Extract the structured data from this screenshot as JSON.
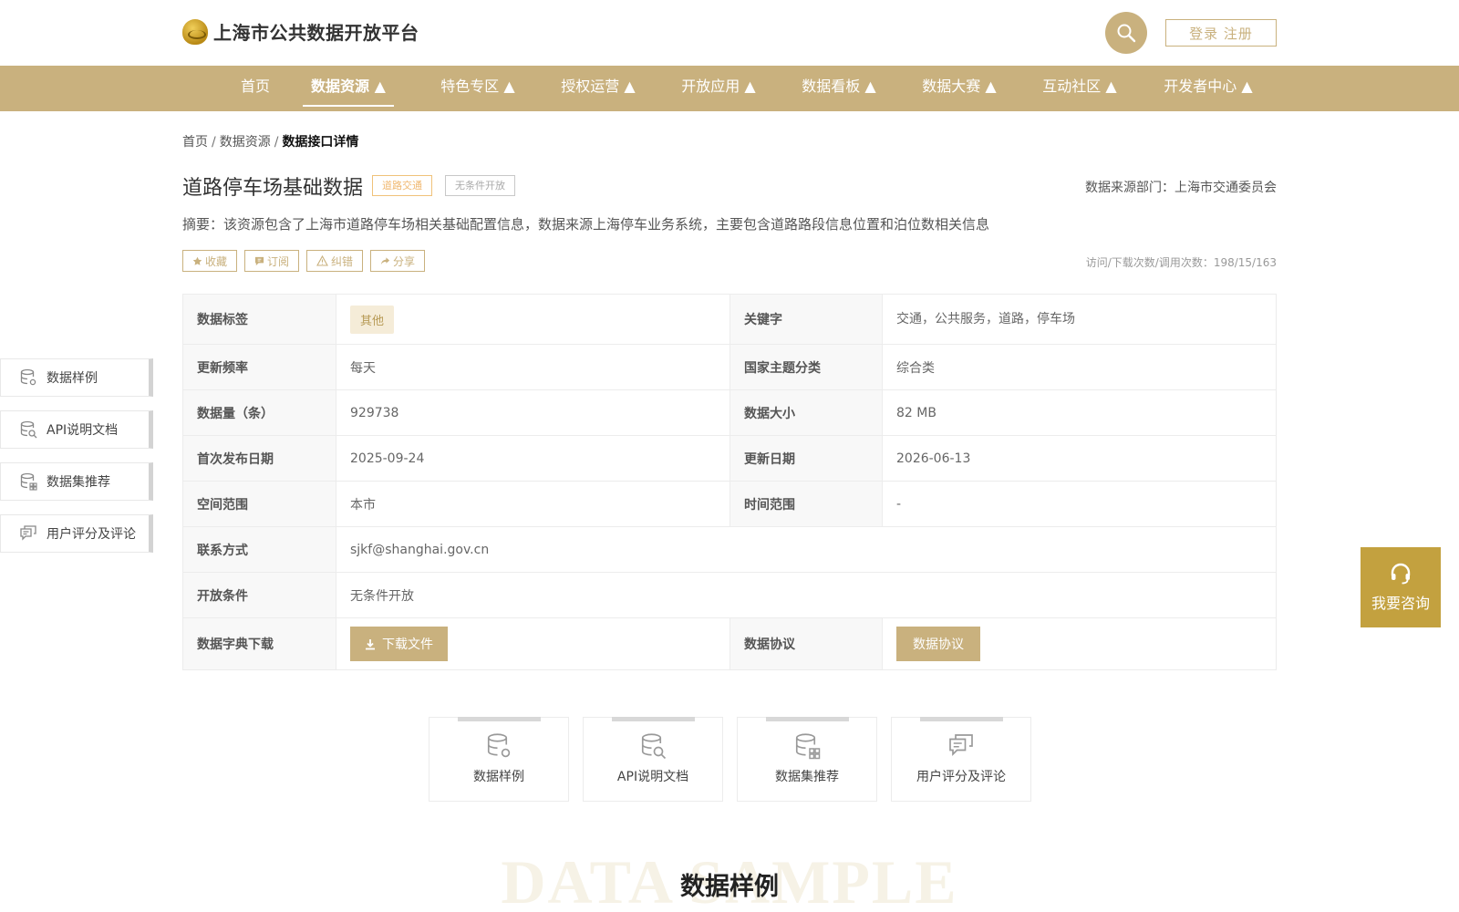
{
  "header": {
    "site_title": "上海市公共数据开放平台",
    "login_label": "登录 注册",
    "logo_icon": "emblem-icon",
    "search_icon": "search-icon"
  },
  "nav": {
    "items": [
      {
        "label": "首页"
      },
      {
        "label": "数据资源 ▲"
      },
      {
        "label": "特色专区 ▲"
      },
      {
        "label": "授权运营 ▲"
      },
      {
        "label": "开放应用 ▲"
      },
      {
        "label": "数据看板 ▲"
      },
      {
        "label": "数据大赛 ▲"
      },
      {
        "label": "互动社区 ▲"
      },
      {
        "label": "开发者中心 ▲"
      }
    ],
    "active_index": 1
  },
  "breadcrumb": {
    "home": "首页",
    "sep1": "/",
    "section": "数据资源",
    "sep2": "/",
    "current": "数据接口详情"
  },
  "resource": {
    "title": "道路停车场基础数据",
    "tag_category": "道路交通",
    "tag_open": "无条件开放",
    "source": "数据来源部门：上海市交通委员会",
    "summary": "摘要：该资源包含了上海市道路停车场相关基础配置信息，数据来源上海停车业务系统，主要包含道路路段信息位置和泊位数相关信息",
    "stats": "访问/下载次数/调用次数：198/15/163"
  },
  "actions": {
    "favorite": "收藏",
    "subscribe": "订阅",
    "report": "纠错",
    "share": "分享"
  },
  "table": {
    "data_tag_label": "数据标签",
    "data_tag_value": "其他",
    "keywords_label": "关键字",
    "keywords_value": "交通，公共服务，道路，停车场",
    "frequency_label": "更新频率",
    "frequency_value": "每天",
    "theme_label": "国家主题分类",
    "theme_value": "综合类",
    "count_label": "数据量（条）",
    "count_value": "929738",
    "size_label": "数据大小",
    "size_value": "82 MB",
    "first_date_label": "首次发布日期",
    "first_date_value": "2025-09-24",
    "update_date_label": "更新日期",
    "update_date_value": "2026-06-13",
    "space_label": "空间范围",
    "space_value": "本市",
    "time_label": "时间范围",
    "time_value": "-",
    "contact_label": "联系方式",
    "contact_value": "sjkf@shanghai.gov.cn",
    "condition_label": "开放条件",
    "condition_value": "无条件开放",
    "dict_label": "数据字典下载",
    "dict_button": "下载文件",
    "protocol_label": "数据协议",
    "protocol_button": "数据协议"
  },
  "side_nav": [
    {
      "label": "数据样例",
      "icon": "database-gear-icon"
    },
    {
      "label": "API说明文档",
      "icon": "database-search-icon"
    },
    {
      "label": "数据集推荐",
      "icon": "database-grid-icon"
    },
    {
      "label": "用户评分及评论",
      "icon": "comments-icon"
    }
  ],
  "consult": {
    "label": "我要咨询",
    "icon": "headset-icon"
  },
  "cards": [
    {
      "label": "数据样例",
      "icon": "database-gear-icon"
    },
    {
      "label": "API说明文档",
      "icon": "database-search-icon"
    },
    {
      "label": "数据集推荐",
      "icon": "database-grid-icon"
    },
    {
      "label": "用户评分及评论",
      "icon": "comments-icon"
    }
  ],
  "section": {
    "bg_text": "DATA SAMPLE",
    "title": "数据样例"
  },
  "colors": {
    "brand_gold": "#c9b17e",
    "consult_gold": "#c3a13f",
    "tag_orange": "#f0b870"
  }
}
